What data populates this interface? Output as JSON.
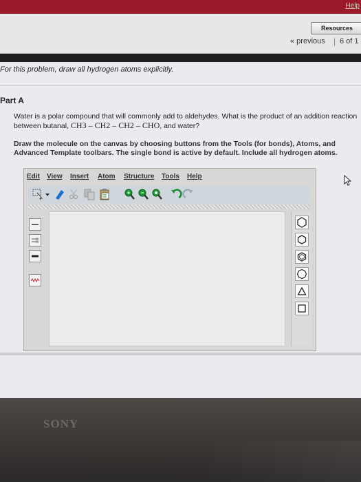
{
  "header": {
    "help_label": "Help"
  },
  "resources": {
    "label": "Resources"
  },
  "navigation": {
    "previous_label": "« previous",
    "page_count": "6 of 1"
  },
  "problem": {
    "intro": "For this problem, draw all hydrogen atoms explicitly.",
    "part_title": "Part A",
    "question_text": "Water is a polar compound that will commonly add to aldehydes. What is the product of an addition reaction between butanal,",
    "question_formula": "CH3 – CH2 – CH2 – CHO",
    "question_tail": ", and water?",
    "instructions": "Draw the molecule on the canvas by choosing buttons from the Tools (for bonds), Atoms, and Advanced Template toolbars. The single bond is active by default. Include all hydrogen atoms."
  },
  "editor": {
    "menu": [
      "Edit",
      "View",
      "Insert",
      "Atom",
      "Structure",
      "Tools",
      "Help"
    ],
    "toolbar_icons": [
      "select-lasso-icon",
      "dropdown-arrow-icon",
      "eraser-icon",
      "scissors-icon",
      "copy-icon",
      "paste-icon",
      "zoom-in-icon",
      "zoom-out-icon",
      "zoom-fit-icon",
      "undo-icon",
      "redo-icon"
    ],
    "bond_tools": [
      "single-bond-icon",
      "double-bond-icon",
      "triple-bond-icon",
      "wedge-bond-icon",
      "wavy-bond-icon"
    ],
    "templates": [
      "benzene-icon",
      "cyclohexane-icon",
      "cycloheptane-icon",
      "cyclopentane-icon",
      "cyclopropane-icon",
      "cyclobutane-icon"
    ]
  },
  "bezel": {
    "brand": "SONY"
  }
}
